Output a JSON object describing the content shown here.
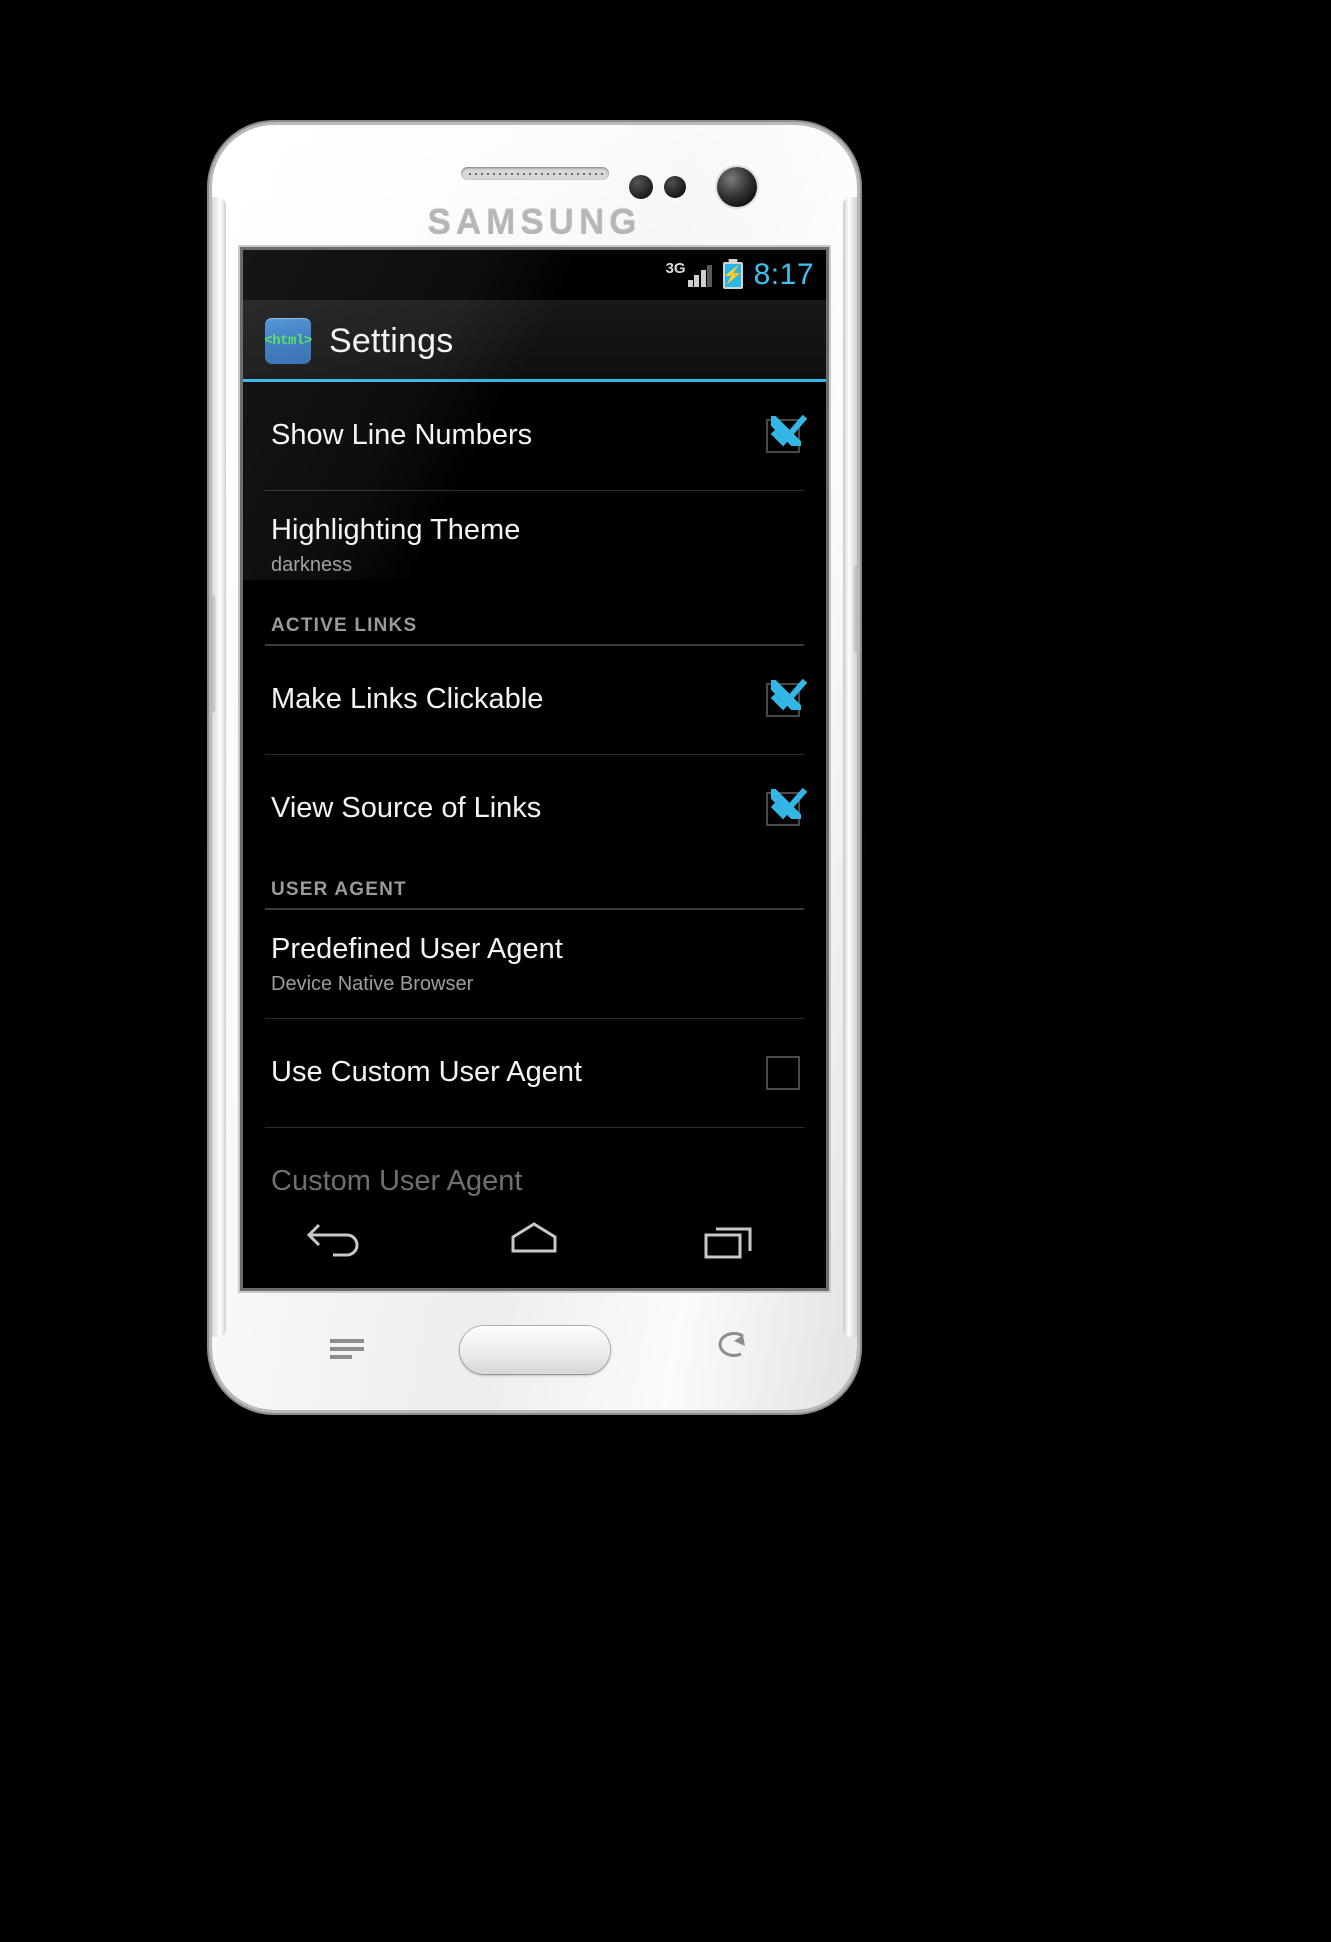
{
  "device": {
    "brand": "SAMSUNG",
    "hardware": {
      "earpiece": "earpiece-speaker",
      "front_camera": "front-camera",
      "proximity_sensor": "proximity-sensor",
      "home_button": "home-button",
      "menu_capacitive_key": "menu-key",
      "back_capacitive_key": "back-key",
      "volume_rocker": "volume-rocker",
      "power_button": "power-button"
    }
  },
  "statusbar": {
    "network_label": "3G",
    "signal_icon": "signal-bars-icon",
    "battery_icon": "battery-charging-icon",
    "battery_bolt": "⚡",
    "time": "8:17",
    "time_color": "#3ec1ef"
  },
  "actionbar": {
    "app_icon_label": "<html>",
    "app_icon_name": "html-app-icon",
    "title": "Settings",
    "accent_color": "#33b5e5"
  },
  "list": [
    {
      "kind": "checkbox-row",
      "name": "show-line-numbers",
      "title": "Show Line Numbers",
      "subtitle": "",
      "checked": true,
      "enabled": true
    },
    {
      "kind": "value-row",
      "name": "highlighting-theme",
      "title": "Highlighting Theme",
      "subtitle": "darkness",
      "enabled": true
    },
    {
      "kind": "section",
      "name": "section-active-links",
      "title": "ACTIVE LINKS"
    },
    {
      "kind": "checkbox-row",
      "name": "make-links-clickable",
      "title": "Make Links Clickable",
      "subtitle": "",
      "checked": true,
      "enabled": true
    },
    {
      "kind": "checkbox-row",
      "name": "view-source-of-links",
      "title": "View Source of Links",
      "subtitle": "",
      "checked": true,
      "enabled": true
    },
    {
      "kind": "section",
      "name": "section-user-agent",
      "title": "USER AGENT"
    },
    {
      "kind": "value-row",
      "name": "predefined-user-agent",
      "title": "Predefined User Agent",
      "subtitle": "Device Native Browser",
      "enabled": true
    },
    {
      "kind": "checkbox-row",
      "name": "use-custom-user-agent",
      "title": "Use Custom User Agent",
      "subtitle": "",
      "checked": false,
      "enabled": true
    },
    {
      "kind": "value-row",
      "name": "custom-user-agent",
      "title": "Custom User Agent",
      "subtitle": "",
      "enabled": false
    }
  ],
  "navbar": {
    "back": "back-nav-icon",
    "home": "home-nav-icon",
    "recents": "recent-apps-nav-icon"
  }
}
